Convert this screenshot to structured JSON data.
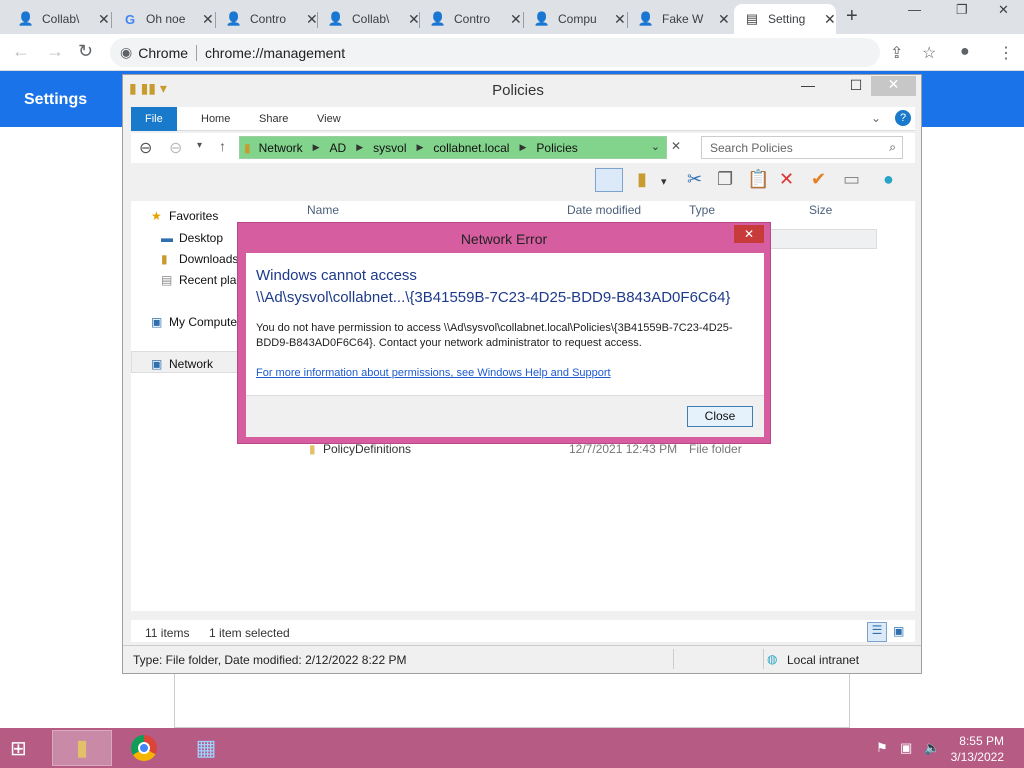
{
  "chrome": {
    "tabs": [
      {
        "title": "Collab\\",
        "icon": "user-icon"
      },
      {
        "title": "Oh noe",
        "icon": "google-icon"
      },
      {
        "title": "Contro",
        "icon": "user-icon"
      },
      {
        "title": "Collab\\",
        "icon": "user-icon"
      },
      {
        "title": "Contro",
        "icon": "user-icon"
      },
      {
        "title": "Compu",
        "icon": "user-icon"
      },
      {
        "title": "Fake W",
        "icon": "user-icon"
      },
      {
        "title": "Setting",
        "icon": "settings-page-icon"
      }
    ],
    "omnibox_host": "Chrome",
    "omnibox_url": "chrome://management"
  },
  "settings": {
    "title": "Settings"
  },
  "explorer": {
    "title": "Policies",
    "ribbon_tabs": [
      "File",
      "Home",
      "Share",
      "View"
    ],
    "breadcrumbs": [
      "Network",
      "AD",
      "sysvol",
      "collabnet.local",
      "Policies"
    ],
    "search_placeholder": "Search Policies",
    "nav": {
      "favorites": "Favorites",
      "desktop": "Desktop",
      "downloads": "Downloads",
      "recent": "Recent pla",
      "computer": "My Compute",
      "network": "Network"
    },
    "columns": {
      "name": "Name",
      "date": "Date modified",
      "type": "Type",
      "size": "Size"
    },
    "rows": [
      {
        "name": "PolicyDefinitions",
        "date": "12/7/2021 12:43 PM",
        "type": "File folder"
      }
    ],
    "status_items": "11 items",
    "status_selected": "1 item selected",
    "details": "Type: File folder, Date modified: 2/12/2022 8:22 PM",
    "zone": "Local intranet"
  },
  "dialog": {
    "title": "Network Error",
    "heading1": "Windows cannot access",
    "heading2": "\\\\Ad\\sysvol\\collabnet...\\{3B41559B-7C23-4D25-BDD9-B843AD0F6C64}",
    "message": "You do not have permission to access \\\\Ad\\sysvol\\collabnet.local\\Policies\\{3B41559B-7C23-4D25-BDD9-B843AD0F6C64}. Contact your network administrator to request access.",
    "link": "For more information about permissions, see Windows Help and Support",
    "close_label": "Close"
  },
  "taskbar": {
    "time": "8:55 PM",
    "date": "3/13/2022"
  },
  "colors": {
    "taskbar": "#b55b84",
    "dialog_frame": "#d65ea0",
    "address_bar": "#82d38b",
    "settings_blue": "#1a73e8"
  }
}
